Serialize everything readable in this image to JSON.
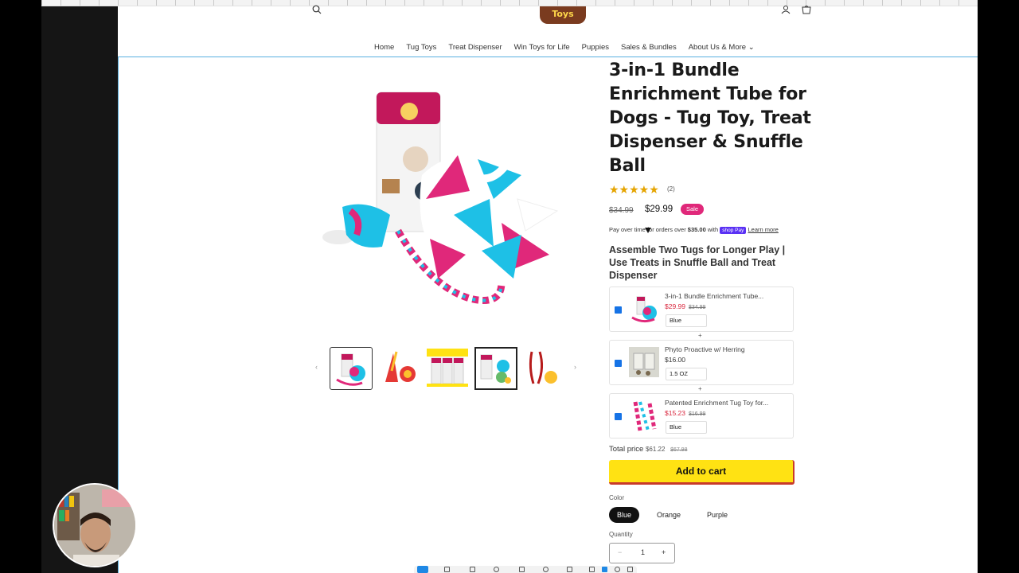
{
  "header": {
    "logo_text": "Toys",
    "search_icon": "search-icon",
    "account_icon": "account-icon",
    "cart_icon": "cart-icon"
  },
  "nav": {
    "items": [
      "Home",
      "Tug Toys",
      "Treat Dispenser",
      "Win Toys for Life",
      "Puppies",
      "Sales & Bundles",
      "About Us & More"
    ]
  },
  "product": {
    "title": "3-in-1 Bundle Enrichment Tube for Dogs - Tug Toy, Treat Dispenser & Snuffle Ball",
    "stars": "★★★★★",
    "rating": 5,
    "review_count": "(2)",
    "compare_price": "$34.99",
    "price": "$29.99",
    "sale_badge": "Sale",
    "pay_text_1": "Pay over time for orders over",
    "pay_amount": "$35.00",
    "pay_with": "with",
    "shop_pay": "shop Pay",
    "learn_more": "Learn more",
    "thumbnails": 5
  },
  "bundle": {
    "heading": "Assemble Two Tugs for Longer Play | Use Treats in Snuffle Ball and Treat Dispenser",
    "items": [
      {
        "name": "3-in-1 Bundle Enrichment Tube...",
        "price": "$29.99",
        "compare": "$34.99",
        "option": "Blue"
      },
      {
        "name": "Phyto Proactive w/ Herring",
        "price": "$16.00",
        "compare": "",
        "option": "1.5 OZ"
      },
      {
        "name": "Patented Enrichment Tug Toy for...",
        "price": "$15.23",
        "compare": "$16.99",
        "option": "Blue"
      }
    ],
    "plus": "+",
    "total_label": "Total price",
    "total_price": "$61.22",
    "total_compare": "$67.98",
    "add_to_cart": "Add to cart"
  },
  "options": {
    "color_label": "Color",
    "colors": [
      "Blue",
      "Orange",
      "Purple"
    ],
    "selected_color": "Blue",
    "quantity_label": "Quantity",
    "quantity": "1",
    "minus": "−",
    "plus": "+"
  },
  "colors": {
    "accent_yellow": "#ffe213",
    "sale_pink": "#e0287a",
    "checkbox_blue": "#1673e6",
    "star_gold": "#e5a400"
  }
}
